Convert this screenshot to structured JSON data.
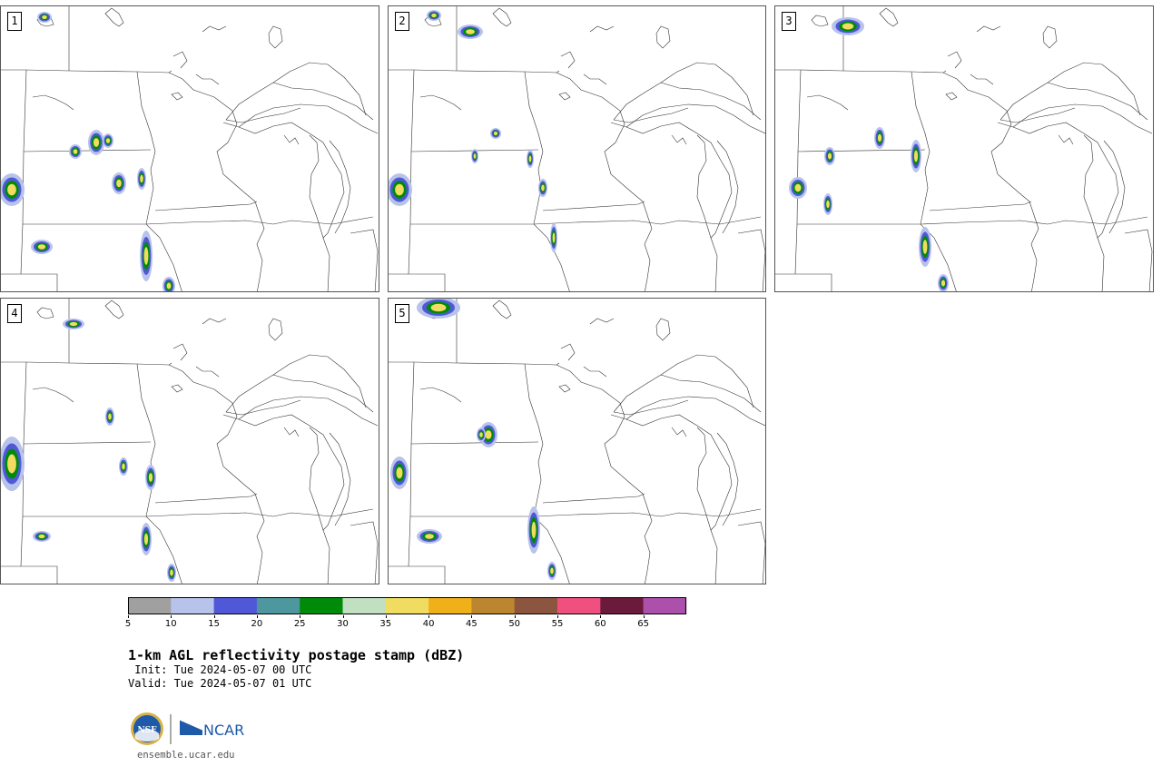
{
  "panels": [
    {
      "number": "1"
    },
    {
      "number": "2"
    },
    {
      "number": "3"
    },
    {
      "number": "4"
    },
    {
      "number": "5"
    }
  ],
  "colorbar": {
    "colors": [
      "#a0a0a0",
      "#b8c3ec",
      "#5058d8",
      "#4e979f",
      "#008a0a",
      "#c1dfc1",
      "#f0dc60",
      "#f0b01a",
      "#bc8530",
      "#8c5540",
      "#f05080",
      "#6a1a3a",
      "#ac50ac"
    ],
    "tick_labels": [
      "5",
      "10",
      "15",
      "20",
      "25",
      "30",
      "35",
      "40",
      "45",
      "50",
      "55",
      "60",
      "65"
    ]
  },
  "title": "1-km AGL reflectivity postage stamp (dBZ)",
  "init_line": " Init: Tue 2024-05-07 00 UTC",
  "valid_line": "Valid: Tue 2024-05-07 01 UTC",
  "logo": {
    "nsf_text": "NSF",
    "ncar_text": "NCAR"
  },
  "website": "ensemble.ucar.edu"
}
